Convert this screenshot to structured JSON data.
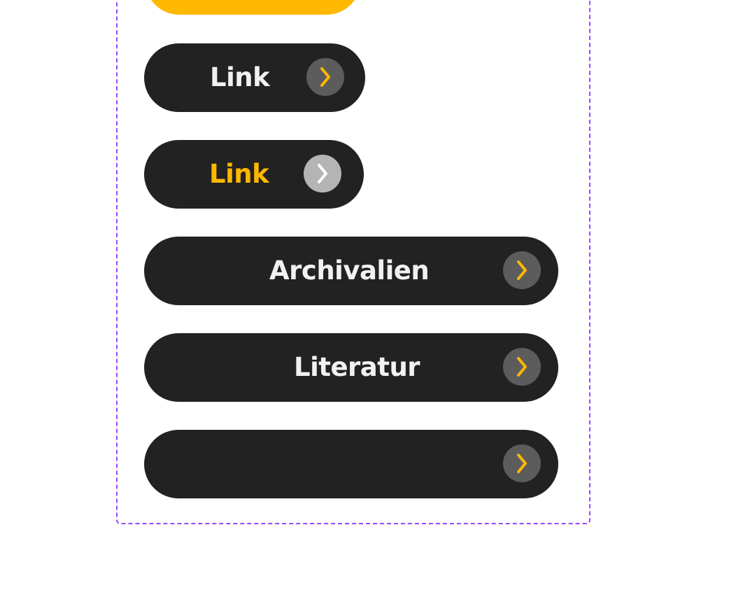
{
  "colors": {
    "frame_border": "#9747ff",
    "button_bg": "#222222",
    "label_default": "#f1f1f1",
    "accent": "#ffb800",
    "arrow_circle_default": "#5c5c5c",
    "arrow_circle_hover": "#b4b4b4"
  },
  "buttons": [
    {
      "label": "Link",
      "state": "default",
      "icon": "chevron-right-icon"
    },
    {
      "label": "Link",
      "state": "hover",
      "icon": "chevron-right-icon"
    },
    {
      "label": "Archivalien",
      "state": "default",
      "icon": "chevron-right-icon"
    },
    {
      "label": "Literatur",
      "state": "default",
      "icon": "chevron-right-icon"
    },
    {
      "label": "",
      "state": "default",
      "icon": "chevron-right-icon"
    }
  ]
}
